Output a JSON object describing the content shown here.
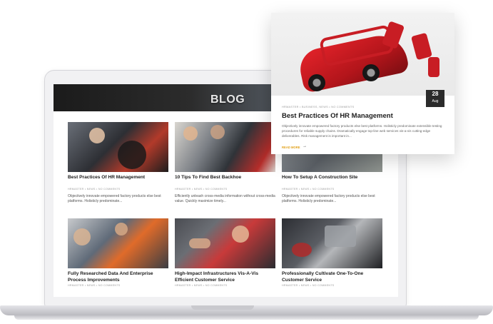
{
  "hero": {
    "title": "BLOG"
  },
  "cards": [
    {
      "title": "Best Practices Of HR Management",
      "meta": "HRMASTER  •  NEWS  •  NO COMMENTS",
      "excerpt": "Objectively innovate empowered factory products else best platforms. Holisticly predominate..."
    },
    {
      "title": "10 Tips To Find Best Backhoe",
      "meta": "HRMASTER  •  NEWS  •  NO COMMENTS",
      "excerpt": "Efficiently unleash cross-media information without cross-media value. Quickly maximize timely..."
    },
    {
      "title": "How To Setup A Construction Site",
      "meta": "HRMASTER  •  NEWS  •  NO COMMENTS",
      "excerpt": "Objectively innovate empowered factory products else best platforms. Holisticly predominate..."
    },
    {
      "title": "Fully Researched Data And Enterprise Process Improvements",
      "meta": "HRMASTER  •  NEWS  •  NO COMMENTS",
      "excerpt": ""
    },
    {
      "title": "High-Impact Infrastructures Vis-A-Vis Efficient Customer Service",
      "meta": "HRMASTER  •  NEWS  •  NO COMMENTS",
      "excerpt": ""
    },
    {
      "title": "Professionally Cultivate One-To-One Customer Service",
      "meta": "HRMASTER  •  NEWS  •  NO COMMENTS",
      "excerpt": ""
    }
  ],
  "featured": {
    "day": "28",
    "month": "Aug",
    "meta": "HRMASTER  •  BUSINESS, NEWS  •  NO COMMENTS",
    "title": "Best Practices Of HR Management",
    "excerpt": "Objectively innovate empowered factory products else best platforms. Holisticly predominate extensible testing procedures for reliable supply chains. Dramatically engage top-line web services vis-a-vis cutting-edge deliverables. Risk management is important in...",
    "read_more": "READ MORE"
  }
}
